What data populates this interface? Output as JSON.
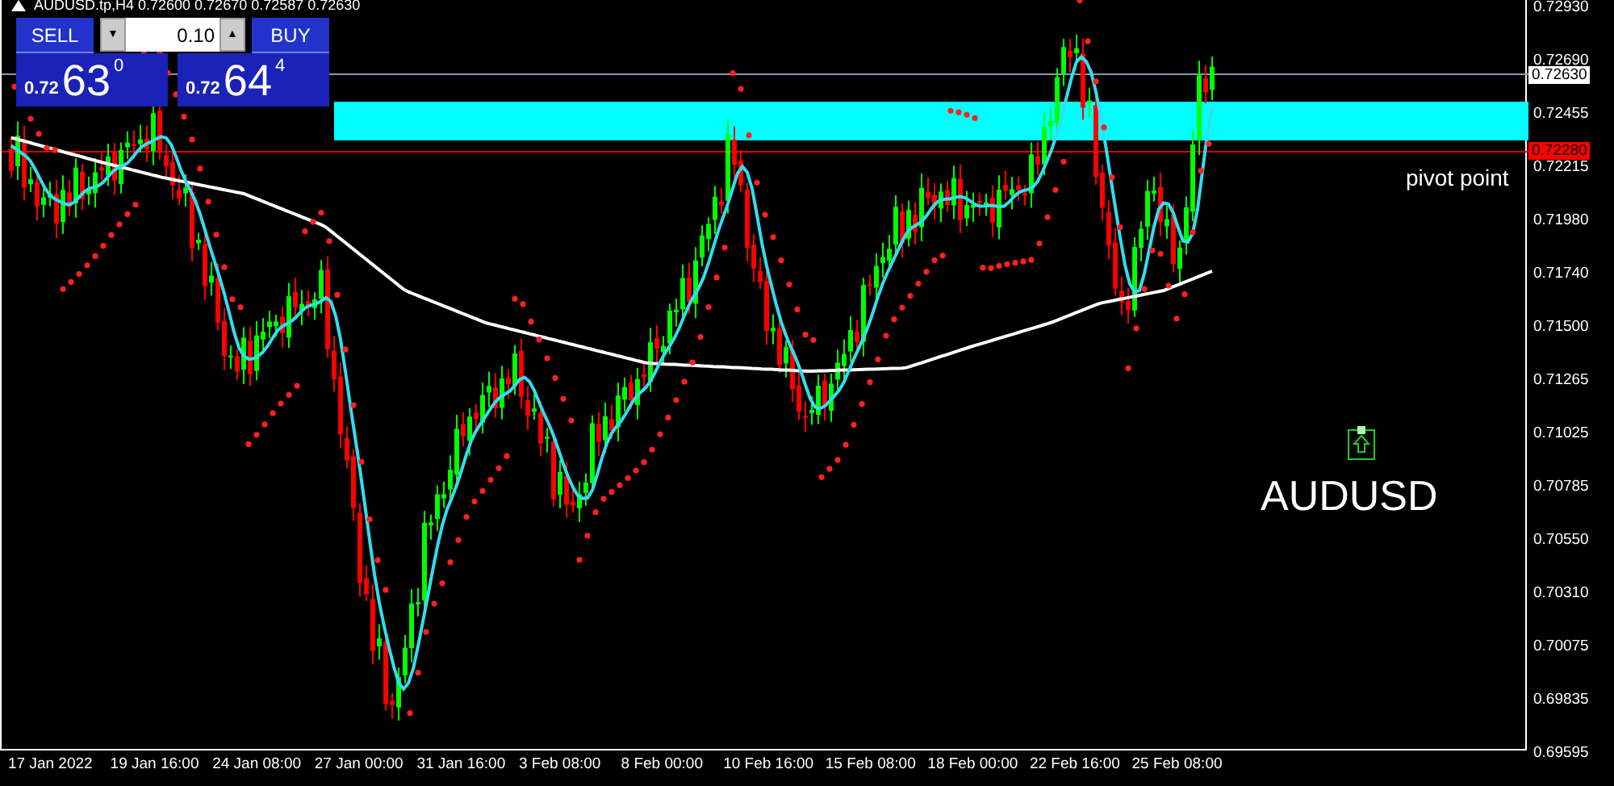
{
  "chart_title": "AUDUSD.tp,H4  0.72600 0.72670 0.72587 0.72630",
  "trade_panel": {
    "sell_label": "SELL",
    "buy_label": "BUY",
    "lot_down": "▼",
    "lot": "0.10",
    "lot_up": "▲",
    "bid": {
      "prefix": "0.72",
      "big": "63",
      "sup": "0"
    },
    "ask": {
      "prefix": "0.72",
      "big": "64",
      "sup": "4"
    }
  },
  "price_axis": {
    "ticks": [
      "0.72930",
      "0.72690",
      "0.72455",
      "0.72215",
      "0.71980",
      "0.71740",
      "0.71500",
      "0.71265",
      "0.71025",
      "0.70785",
      "0.70550",
      "0.70310",
      "0.70075",
      "0.69835",
      "0.69595"
    ],
    "current_price": "0.72630",
    "pivot_price": "0.72280"
  },
  "time_axis": [
    "17 Jan 2022",
    "19 Jan 16:00",
    "24 Jan 08:00",
    "27 Jan 00:00",
    "31 Jan 16:00",
    "3 Feb 08:00",
    "8 Feb 00:00",
    "10 Feb 16:00",
    "15 Feb 08:00",
    "18 Feb 00:00",
    "22 Feb 16:00",
    "25 Feb 08:00"
  ],
  "pivot_label": "pivot point",
  "symbol_label": "AUDUSD"
}
